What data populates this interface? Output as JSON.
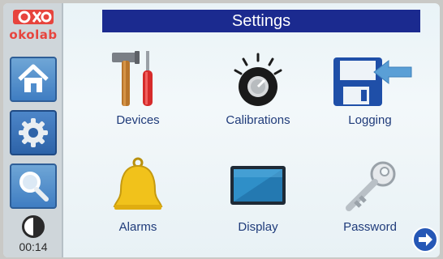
{
  "app": {
    "brand": "okolab",
    "title": "Settings",
    "clock": "00:14"
  },
  "sidebar": {
    "items": [
      {
        "name": "home",
        "icon": "home-icon",
        "active": false
      },
      {
        "name": "settings",
        "icon": "gear-icon",
        "active": true
      },
      {
        "name": "search",
        "icon": "magnifier-icon",
        "active": false
      }
    ]
  },
  "settings": {
    "items": [
      {
        "label": "Devices",
        "icon": "tools-icon"
      },
      {
        "label": "Calibrations",
        "icon": "knob-icon"
      },
      {
        "label": "Logging",
        "icon": "floppy-disk-icon"
      },
      {
        "label": "Alarms",
        "icon": "bell-icon"
      },
      {
        "label": "Display",
        "icon": "monitor-icon"
      },
      {
        "label": "Password",
        "icon": "key-icon"
      }
    ]
  },
  "colors": {
    "title_bar": "#1b2a8f",
    "sidebar_button": "#3f7dc2",
    "label": "#1f3b7a",
    "arrow_annotation": "#5a9fd6"
  }
}
